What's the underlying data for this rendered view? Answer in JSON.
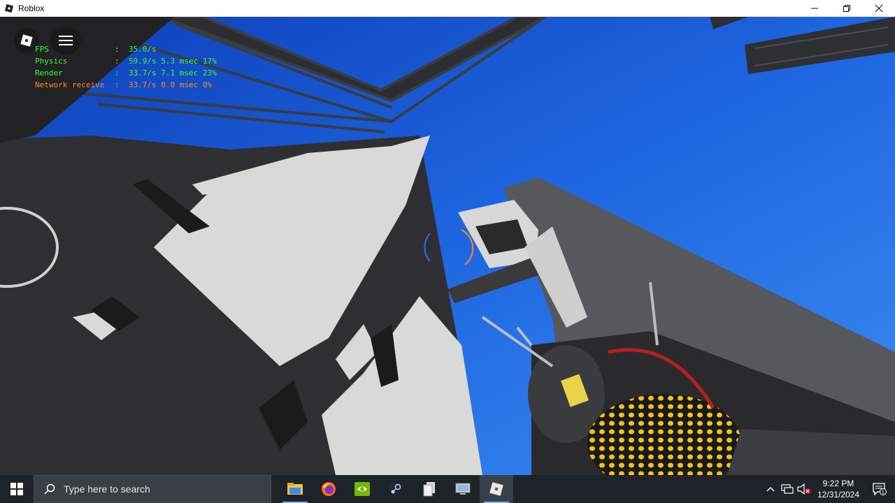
{
  "window": {
    "title": "Roblox"
  },
  "overlay": {
    "stats": [
      {
        "name": "FPS",
        "value": ":  35.0/s",
        "color": "#3cff2e"
      },
      {
        "name": "Physics",
        "value": ":  59.9/s 5.3 msec 17%",
        "color": "#3cff2e"
      },
      {
        "name": "Render",
        "value": ":  33.7/s 7.1 msec 23%",
        "color": "#3cff2e"
      },
      {
        "name": "Network receive",
        "value": ":  33.7/s 0.0 msec 0%",
        "color": "#ff8a1c"
      }
    ]
  },
  "taskbar": {
    "search_placeholder": "Type here to search",
    "apps": [
      "file-explorer-icon",
      "firefox-icon",
      "nvidia-icon",
      "steam-icon",
      "files-icon",
      "computer-icon",
      "roblox-icon"
    ],
    "clock": {
      "time": "9:22 PM",
      "date": "12/31/2024"
    },
    "notification_count": "1"
  },
  "colors": {
    "sky": "#1f5fd0",
    "taskbar": "#1e2229",
    "stat_green": "#3cff2e",
    "stat_orange": "#ff8a1c"
  }
}
